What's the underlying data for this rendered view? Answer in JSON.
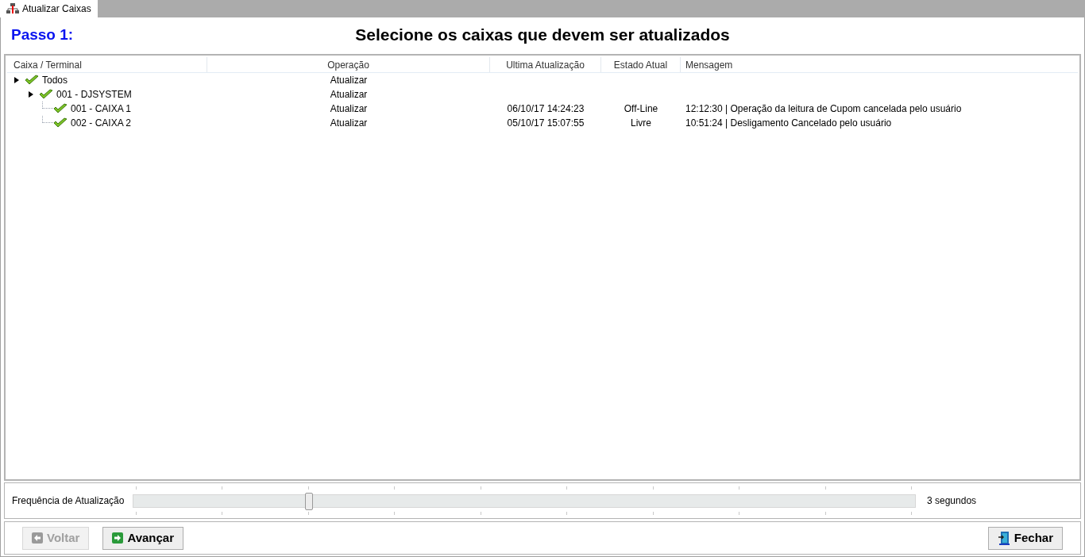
{
  "tab": {
    "label": "Atualizar Caixas",
    "selected": true
  },
  "step": "Passo 1:",
  "heading": "Selecione os caixas que devem ser atualizados",
  "table": {
    "columns": [
      "Caixa / Terminal",
      "Operação",
      "Ultima Atualização",
      "Estado Atual",
      "Mensagem"
    ],
    "rows": [
      {
        "name": "Todos",
        "checked": true,
        "expanded": true,
        "operation": "Atualizar",
        "children": [
          {
            "name": "001 - DJSYSTEM",
            "checked": true,
            "expanded": true,
            "operation": "Atualizar",
            "children": [
              {
                "name": "001 - CAIXA 1",
                "checked": true,
                "operation": "Atualizar",
                "last_update": "06/10/17 14:24:23",
                "state": "Off-Line",
                "message": "12:12:30 | Operação da leitura de Cupom cancelada pelo usuário"
              },
              {
                "name": "002 - CAIXA 2",
                "checked": true,
                "operation": "Atualizar",
                "last_update": "05/10/17 15:07:55",
                "state": "Livre",
                "message": "10:51:24 | Desligamento Cancelado pelo usuário"
              }
            ]
          }
        ]
      }
    ]
  },
  "slider": {
    "label": "Frequência de Atualização",
    "level": 0.222,
    "reading": "3 segundos"
  },
  "buttons": [
    {
      "label": "Voltar",
      "kind": "back",
      "disabled": true
    },
    {
      "label": "Avançar",
      "kind": "next",
      "disabled": false
    },
    {
      "label": "Fechar",
      "kind": "close",
      "disabled": false
    }
  ]
}
